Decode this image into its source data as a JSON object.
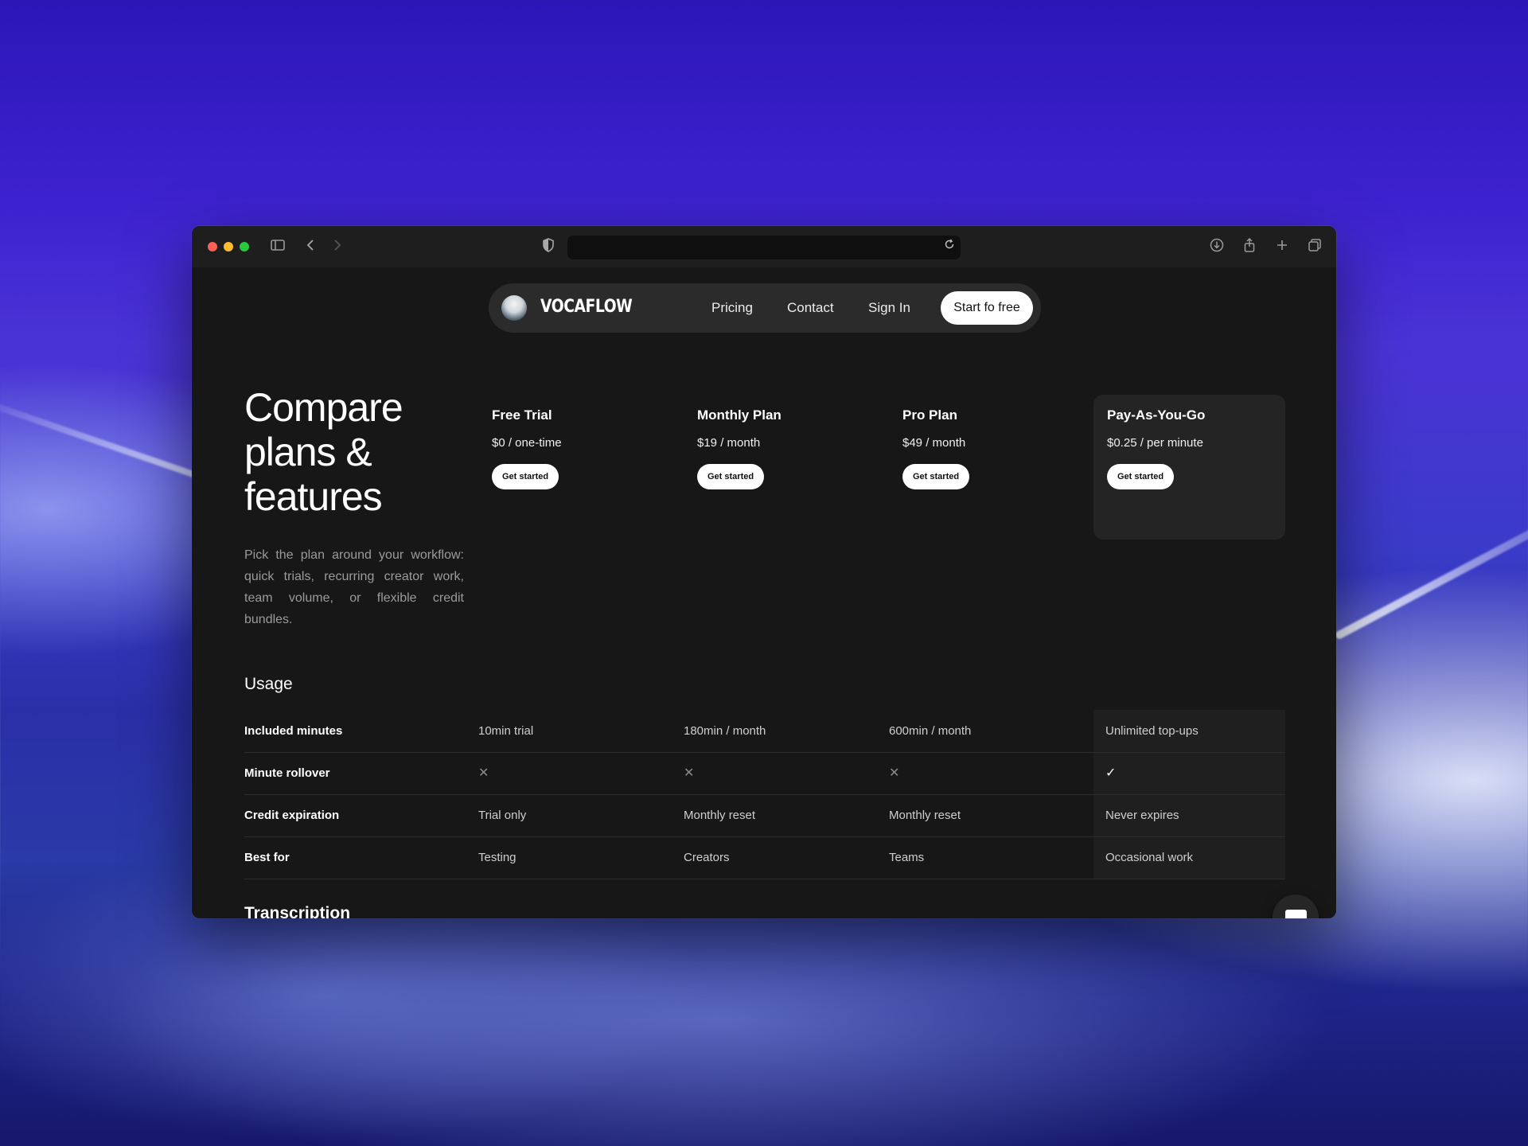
{
  "browser": {
    "icons": {
      "sidebar": "sidebar-icon",
      "back": "chevron-left-icon",
      "forward": "chevron-right-icon",
      "shield": "shield-icon",
      "reload": "reload-icon",
      "download": "download-icon",
      "share": "share-icon",
      "new_tab": "plus-icon",
      "tabs": "tabs-overview-icon"
    },
    "address_value": ""
  },
  "nav": {
    "brand": "VOCAFLOW",
    "links": [
      "Pricing",
      "Contact",
      "Sign In"
    ],
    "cta": "Start fo free"
  },
  "hero": {
    "title": "Compare plans & features",
    "description": "Pick the plan around your workflow: quick trials, recurring creator work, team volume, or flexible credit bundles."
  },
  "plans": [
    {
      "name": "Free Trial",
      "price": "$0 / one-time",
      "button": "Get started"
    },
    {
      "name": "Monthly Plan",
      "price": "$19 / month",
      "button": "Get started"
    },
    {
      "name": "Pro Plan",
      "price": "$49 / month",
      "button": "Get started"
    },
    {
      "name": "Pay-As-You-Go",
      "price": "$0.25 / per minute",
      "button": "Get started",
      "highlighted": true
    }
  ],
  "usage": {
    "title": "Usage",
    "rows": [
      {
        "label": "Included minutes",
        "values": [
          "10min trial",
          "180min / month",
          "600min / month",
          "Unlimited top-ups"
        ]
      },
      {
        "label": "Minute rollover",
        "values": [
          "✕",
          "✕",
          "✕",
          "✓"
        ]
      },
      {
        "label": "Credit expiration",
        "values": [
          "Trial only",
          "Monthly reset",
          "Monthly reset",
          "Never expires"
        ]
      },
      {
        "label": "Best for",
        "values": [
          "Testing",
          "Creators",
          "Teams",
          "Occasional work"
        ]
      }
    ]
  },
  "next_section_title": "Transcription",
  "chat": {
    "icon": "chat-icon"
  },
  "colors": {
    "page_bg": "#171717",
    "nav_bg": "#2b2b2b",
    "highlight_bg": "#242424",
    "button_bg": "#ffffff",
    "accent_text": "#ffffff"
  }
}
